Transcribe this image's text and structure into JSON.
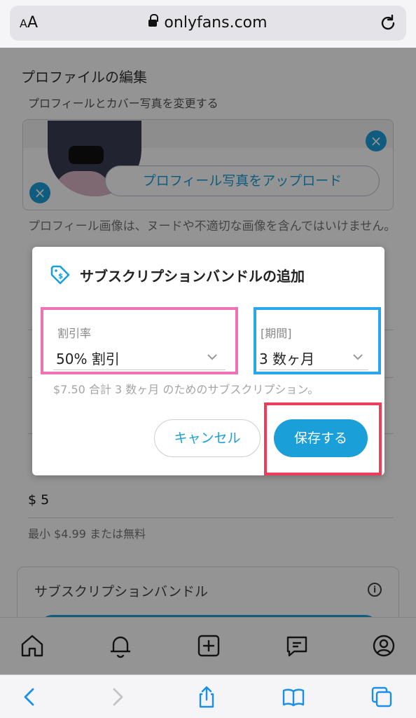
{
  "browser": {
    "aa_label_small": "A",
    "aa_label_large": "A",
    "url": "onlyfans.com"
  },
  "page": {
    "section_title": "プロファイルの編集",
    "section_subtitle": "プロフィールとカバー写真を変更する",
    "upload_button": "プロフィール写真をアップロード",
    "note": "プロフィール画像は、ヌードや不適切な画像を含んではいけません。",
    "price_min": "最小 $4.99 または無料",
    "price_value": "$ 5",
    "bundle_card_title": "サブスクリプションバンドル"
  },
  "modal": {
    "title": "サブスクリプションバンドルの追加",
    "discount_label": "割引率",
    "discount_value": "50% 割引",
    "period_label": "[期間]",
    "period_value": "3 数ヶ月",
    "helper_text": "$7.50 合計 3 数ヶ月 のためのサブスクリプション。",
    "cancel_label": "キャンセル",
    "save_label": "保存する"
  },
  "colors": {
    "accent": "#1a9fd9",
    "highlight_pink": "#ef72b4",
    "highlight_blue": "#2aa6ea",
    "highlight_red": "#ee3c5b"
  },
  "icons": {
    "nav": [
      "home-icon",
      "bell-icon",
      "plus-square-icon",
      "message-icon",
      "profile-icon"
    ],
    "toolbar": [
      "back-icon",
      "forward-icon",
      "share-icon",
      "bookmarks-icon",
      "tabs-icon"
    ]
  }
}
